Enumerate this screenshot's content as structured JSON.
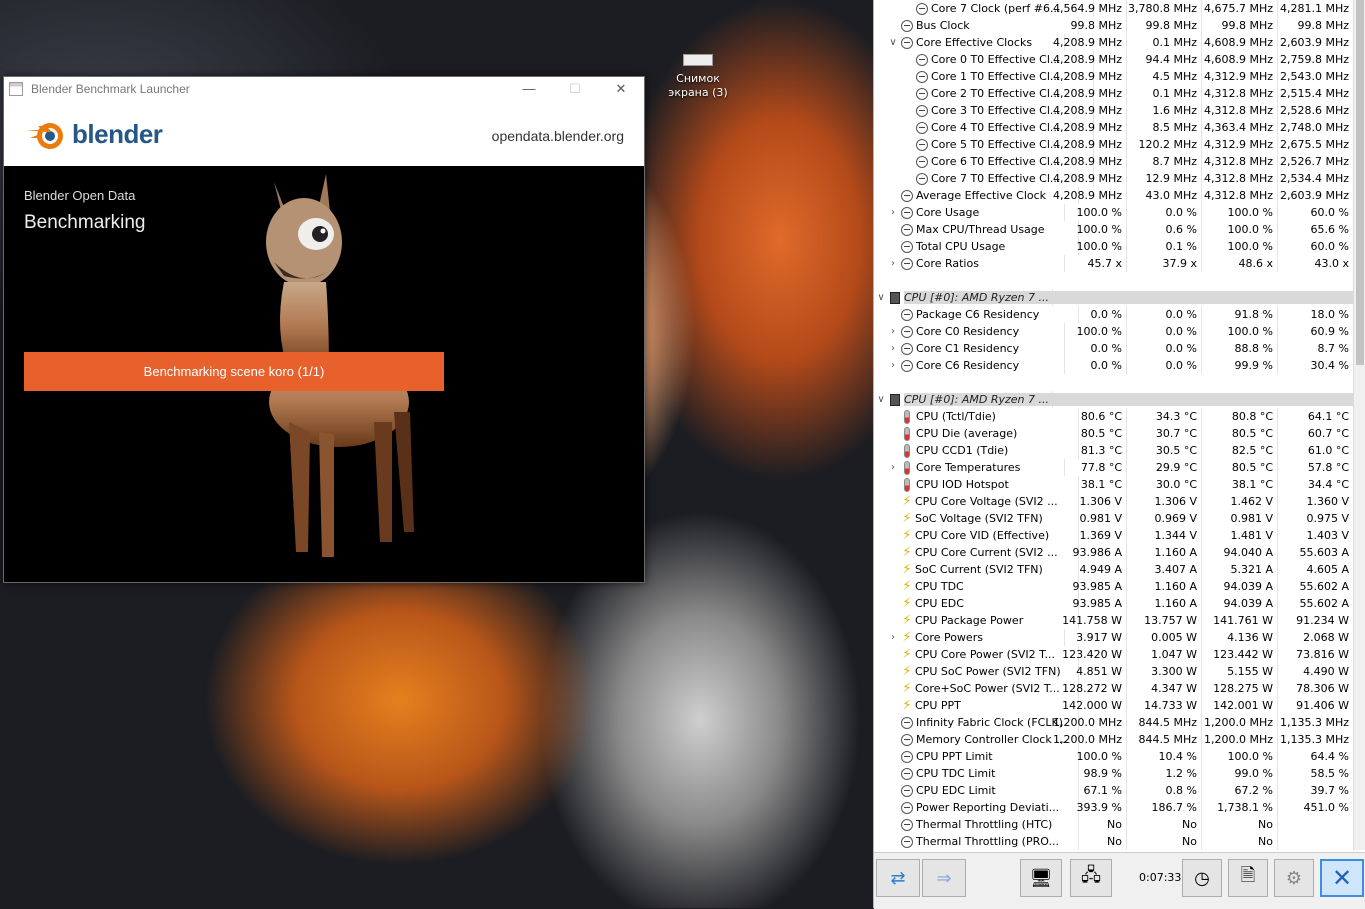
{
  "desktop": {
    "icon_label_line1": "Снимок",
    "icon_label_line2": "экрана (3)"
  },
  "blender_window": {
    "title": "Blender Benchmark Launcher",
    "logo_text": "blender",
    "site_url": "opendata.blender.org",
    "subtitle": "Blender Open Data",
    "heading": "Benchmarking",
    "progress_label": "Benchmarking scene koro (1/1)",
    "accent_color": "#e8612c"
  },
  "hwinfo": {
    "rows": [
      {
        "type": "sensor",
        "indent": 1,
        "icon": "clock-icon",
        "expander": "",
        "name": "Core 7 Clock (perf #6...",
        "values": [
          "4,564.9 MHz",
          "3,780.8 MHz",
          "4,675.7 MHz",
          "4,281.1 MHz"
        ]
      },
      {
        "type": "sensor",
        "indent": 0,
        "icon": "clock-icon",
        "expander": "",
        "name": "Bus Clock",
        "values": [
          "99.8 MHz",
          "99.8 MHz",
          "99.8 MHz",
          "99.8 MHz"
        ]
      },
      {
        "type": "sensor",
        "indent": 0,
        "icon": "clock-icon",
        "expander": "∨",
        "name": "Core Effective Clocks",
        "values": [
          "4,208.9 MHz",
          "0.1 MHz",
          "4,608.9 MHz",
          "2,603.9 MHz"
        ]
      },
      {
        "type": "sensor",
        "indent": 1,
        "icon": "clock-icon",
        "expander": "",
        "name": "Core 0 T0 Effective Cl...",
        "values": [
          "4,208.9 MHz",
          "94.4 MHz",
          "4,608.9 MHz",
          "2,759.8 MHz"
        ]
      },
      {
        "type": "sensor",
        "indent": 1,
        "icon": "clock-icon",
        "expander": "",
        "name": "Core 1 T0 Effective Cl...",
        "values": [
          "4,208.9 MHz",
          "4.5 MHz",
          "4,312.9 MHz",
          "2,543.0 MHz"
        ]
      },
      {
        "type": "sensor",
        "indent": 1,
        "icon": "clock-icon",
        "expander": "",
        "name": "Core 2 T0 Effective Cl...",
        "values": [
          "4,208.9 MHz",
          "0.1 MHz",
          "4,312.8 MHz",
          "2,515.4 MHz"
        ]
      },
      {
        "type": "sensor",
        "indent": 1,
        "icon": "clock-icon",
        "expander": "",
        "name": "Core 3 T0 Effective Cl...",
        "values": [
          "4,208.9 MHz",
          "1.6 MHz",
          "4,312.8 MHz",
          "2,528.6 MHz"
        ]
      },
      {
        "type": "sensor",
        "indent": 1,
        "icon": "clock-icon",
        "expander": "",
        "name": "Core 4 T0 Effective Cl...",
        "values": [
          "4,208.9 MHz",
          "8.5 MHz",
          "4,363.4 MHz",
          "2,748.0 MHz"
        ]
      },
      {
        "type": "sensor",
        "indent": 1,
        "icon": "clock-icon",
        "expander": "",
        "name": "Core 5 T0 Effective Cl...",
        "values": [
          "4,208.9 MHz",
          "120.2 MHz",
          "4,312.9 MHz",
          "2,675.5 MHz"
        ]
      },
      {
        "type": "sensor",
        "indent": 1,
        "icon": "clock-icon",
        "expander": "",
        "name": "Core 6 T0 Effective Cl...",
        "values": [
          "4,208.9 MHz",
          "8.7 MHz",
          "4,312.8 MHz",
          "2,526.7 MHz"
        ]
      },
      {
        "type": "sensor",
        "indent": 1,
        "icon": "clock-icon",
        "expander": "",
        "name": "Core 7 T0 Effective Cl...",
        "values": [
          "4,208.9 MHz",
          "12.9 MHz",
          "4,312.8 MHz",
          "2,534.4 MHz"
        ]
      },
      {
        "type": "sensor",
        "indent": 0,
        "icon": "clock-icon",
        "expander": "",
        "name": "Average Effective Clock",
        "values": [
          "4,208.9 MHz",
          "43.0 MHz",
          "4,312.8 MHz",
          "2,603.9 MHz"
        ]
      },
      {
        "type": "sensor",
        "indent": 0,
        "icon": "clock-icon",
        "expander": "›",
        "name": "Core Usage",
        "values": [
          "100.0 %",
          "0.0 %",
          "100.0 %",
          "60.0 %"
        ]
      },
      {
        "type": "sensor",
        "indent": 0,
        "icon": "clock-icon",
        "expander": "",
        "name": "Max CPU/Thread Usage",
        "values": [
          "100.0 %",
          "0.6 %",
          "100.0 %",
          "65.6 %"
        ]
      },
      {
        "type": "sensor",
        "indent": 0,
        "icon": "clock-icon",
        "expander": "",
        "name": "Total CPU Usage",
        "values": [
          "100.0 %",
          "0.1 %",
          "100.0 %",
          "60.0 %"
        ]
      },
      {
        "type": "sensor",
        "indent": 0,
        "icon": "clock-icon",
        "expander": "›",
        "name": "Core Ratios",
        "values": [
          "45.7 x",
          "37.9 x",
          "48.6 x",
          "43.0 x"
        ]
      },
      {
        "type": "blank"
      },
      {
        "type": "group",
        "name": "CPU [#0]: AMD Ryzen 7 ..."
      },
      {
        "type": "sensor",
        "indent": 0,
        "icon": "clock-icon",
        "expander": "",
        "name": "Package C6 Residency",
        "values": [
          "0.0 %",
          "0.0 %",
          "91.8 %",
          "18.0 %"
        ]
      },
      {
        "type": "sensor",
        "indent": 0,
        "icon": "clock-icon",
        "expander": "›",
        "name": "Core C0 Residency",
        "values": [
          "100.0 %",
          "0.0 %",
          "100.0 %",
          "60.9 %"
        ]
      },
      {
        "type": "sensor",
        "indent": 0,
        "icon": "clock-icon",
        "expander": "›",
        "name": "Core C1 Residency",
        "values": [
          "0.0 %",
          "0.0 %",
          "88.8 %",
          "8.7 %"
        ]
      },
      {
        "type": "sensor",
        "indent": 0,
        "icon": "clock-icon",
        "expander": "›",
        "name": "Core C6 Residency",
        "values": [
          "0.0 %",
          "0.0 %",
          "99.9 %",
          "30.4 %"
        ]
      },
      {
        "type": "blank"
      },
      {
        "type": "group",
        "name": "CPU [#0]: AMD Ryzen 7 ..."
      },
      {
        "type": "sensor",
        "indent": 0,
        "icon": "thermometer-icon",
        "expander": "",
        "name": "CPU (Tctl/Tdie)",
        "values": [
          "80.6 °C",
          "34.3 °C",
          "80.8 °C",
          "64.1 °C"
        ]
      },
      {
        "type": "sensor",
        "indent": 0,
        "icon": "thermometer-icon",
        "expander": "",
        "name": "CPU Die (average)",
        "values": [
          "80.5 °C",
          "30.7 °C",
          "80.5 °C",
          "60.7 °C"
        ]
      },
      {
        "type": "sensor",
        "indent": 0,
        "icon": "thermometer-icon",
        "expander": "",
        "name": "CPU CCD1 (Tdie)",
        "values": [
          "81.3 °C",
          "30.5 °C",
          "82.5 °C",
          "61.0 °C"
        ]
      },
      {
        "type": "sensor",
        "indent": 0,
        "icon": "thermometer-icon",
        "expander": "›",
        "name": "Core Temperatures",
        "values": [
          "77.8 °C",
          "29.9 °C",
          "80.5 °C",
          "57.8 °C"
        ]
      },
      {
        "type": "sensor",
        "indent": 0,
        "icon": "thermometer-icon",
        "expander": "",
        "name": "CPU IOD Hotspot",
        "values": [
          "38.1 °C",
          "30.0 °C",
          "38.1 °C",
          "34.4 °C"
        ]
      },
      {
        "type": "sensor",
        "indent": 0,
        "icon": "voltage-icon",
        "expander": "",
        "name": "CPU Core Voltage (SVI2 ...",
        "values": [
          "1.306 V",
          "1.306 V",
          "1.462 V",
          "1.360 V"
        ]
      },
      {
        "type": "sensor",
        "indent": 0,
        "icon": "voltage-icon",
        "expander": "",
        "name": "SoC Voltage (SVI2 TFN)",
        "values": [
          "0.981 V",
          "0.969 V",
          "0.981 V",
          "0.975 V"
        ]
      },
      {
        "type": "sensor",
        "indent": 0,
        "icon": "voltage-icon",
        "expander": "",
        "name": "CPU Core VID (Effective)",
        "values": [
          "1.369 V",
          "1.344 V",
          "1.481 V",
          "1.403 V"
        ]
      },
      {
        "type": "sensor",
        "indent": 0,
        "icon": "voltage-icon",
        "expander": "",
        "name": "CPU Core Current (SVI2 ...",
        "values": [
          "93.986 A",
          "1.160 A",
          "94.040 A",
          "55.603 A"
        ]
      },
      {
        "type": "sensor",
        "indent": 0,
        "icon": "voltage-icon",
        "expander": "",
        "name": "SoC Current (SVI2 TFN)",
        "values": [
          "4.949 A",
          "3.407 A",
          "5.321 A",
          "4.605 A"
        ]
      },
      {
        "type": "sensor",
        "indent": 0,
        "icon": "voltage-icon",
        "expander": "",
        "name": "CPU TDC",
        "values": [
          "93.985 A",
          "1.160 A",
          "94.039 A",
          "55.602 A"
        ]
      },
      {
        "type": "sensor",
        "indent": 0,
        "icon": "voltage-icon",
        "expander": "",
        "name": "CPU EDC",
        "values": [
          "93.985 A",
          "1.160 A",
          "94.039 A",
          "55.602 A"
        ]
      },
      {
        "type": "sensor",
        "indent": 0,
        "icon": "voltage-icon",
        "expander": "",
        "name": "CPU Package Power",
        "values": [
          "141.758 W",
          "13.757 W",
          "141.761 W",
          "91.234 W"
        ]
      },
      {
        "type": "sensor",
        "indent": 0,
        "icon": "voltage-icon",
        "expander": "›",
        "name": "Core Powers",
        "values": [
          "3.917 W",
          "0.005 W",
          "4.136 W",
          "2.068 W"
        ]
      },
      {
        "type": "sensor",
        "indent": 0,
        "icon": "voltage-icon",
        "expander": "",
        "name": "CPU Core Power (SVI2 T...",
        "values": [
          "123.420 W",
          "1.047 W",
          "123.442 W",
          "73.816 W"
        ]
      },
      {
        "type": "sensor",
        "indent": 0,
        "icon": "voltage-icon",
        "expander": "",
        "name": "CPU SoC Power (SVI2 TFN)",
        "values": [
          "4.851 W",
          "3.300 W",
          "5.155 W",
          "4.490 W"
        ]
      },
      {
        "type": "sensor",
        "indent": 0,
        "icon": "voltage-icon",
        "expander": "",
        "name": "Core+SoC Power (SVI2 T...",
        "values": [
          "128.272 W",
          "4.347 W",
          "128.275 W",
          "78.306 W"
        ]
      },
      {
        "type": "sensor",
        "indent": 0,
        "icon": "voltage-icon",
        "expander": "",
        "name": "CPU PPT",
        "values": [
          "142.000 W",
          "14.733 W",
          "142.001 W",
          "91.406 W"
        ]
      },
      {
        "type": "sensor",
        "indent": 0,
        "icon": "clock-icon",
        "expander": "",
        "name": "Infinity Fabric Clock (FCLK)",
        "values": [
          "1,200.0 MHz",
          "844.5 MHz",
          "1,200.0 MHz",
          "1,135.3 MHz"
        ]
      },
      {
        "type": "sensor",
        "indent": 0,
        "icon": "clock-icon",
        "expander": "",
        "name": "Memory Controller Clock ...",
        "values": [
          "1,200.0 MHz",
          "844.5 MHz",
          "1,200.0 MHz",
          "1,135.3 MHz"
        ]
      },
      {
        "type": "sensor",
        "indent": 0,
        "icon": "clock-icon",
        "expander": "",
        "name": "CPU PPT Limit",
        "values": [
          "100.0 %",
          "10.4 %",
          "100.0 %",
          "64.4 %"
        ]
      },
      {
        "type": "sensor",
        "indent": 0,
        "icon": "clock-icon",
        "expander": "",
        "name": "CPU TDC Limit",
        "values": [
          "98.9 %",
          "1.2 %",
          "99.0 %",
          "58.5 %"
        ]
      },
      {
        "type": "sensor",
        "indent": 0,
        "icon": "clock-icon",
        "expander": "",
        "name": "CPU EDC Limit",
        "values": [
          "67.1 %",
          "0.8 %",
          "67.2 %",
          "39.7 %"
        ]
      },
      {
        "type": "sensor",
        "indent": 0,
        "icon": "clock-icon",
        "expander": "",
        "name": "Power Reporting Deviati...",
        "values": [
          "393.9 %",
          "186.7 %",
          "1,738.1 %",
          "451.0 %"
        ]
      },
      {
        "type": "sensor",
        "indent": 0,
        "icon": "clock-icon",
        "expander": "",
        "name": "Thermal Throttling (HTC)",
        "values": [
          "No",
          "No",
          "No",
          ""
        ]
      },
      {
        "type": "sensor",
        "indent": 0,
        "icon": "clock-icon",
        "expander": "",
        "name": "Thermal Throttling (PRO...",
        "values": [
          "No",
          "No",
          "No",
          ""
        ]
      }
    ],
    "toolbar": {
      "timer": "0:07:33"
    }
  }
}
